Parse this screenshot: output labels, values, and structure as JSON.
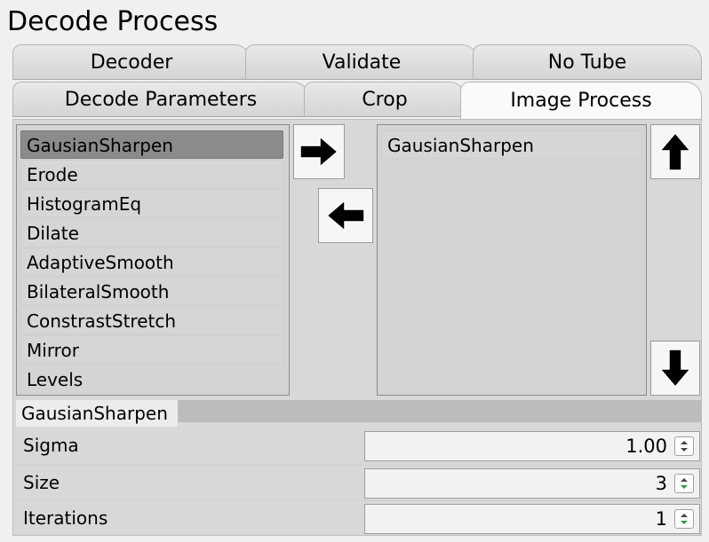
{
  "window": {
    "title": "Decode Process"
  },
  "tabs_top": [
    {
      "label": "Decoder"
    },
    {
      "label": "Validate"
    },
    {
      "label": "No Tube"
    }
  ],
  "tabs_second": [
    {
      "label": "Decode Parameters"
    },
    {
      "label": "Crop"
    },
    {
      "label": "Image Process",
      "active": true
    }
  ],
  "available_list": {
    "items": [
      "GausianSharpen",
      "Erode",
      "HistogramEq",
      "Dilate",
      "AdaptiveSmooth",
      "BilateralSmooth",
      "ConstrastStretch",
      "Mirror",
      "Levels"
    ],
    "selected": "GausianSharpen"
  },
  "active_list": {
    "items": [
      "GausianSharpen"
    ]
  },
  "buttons": {
    "add": "arrow-right-icon",
    "remove": "arrow-left-icon",
    "move_up": "arrow-up-icon",
    "move_down": "arrow-down-icon"
  },
  "properties": {
    "header": "GausianSharpen",
    "rows": [
      {
        "label": "Sigma",
        "value": "1.00"
      },
      {
        "label": "Size",
        "value": "3"
      },
      {
        "label": "Iterations",
        "value": "1"
      }
    ]
  }
}
